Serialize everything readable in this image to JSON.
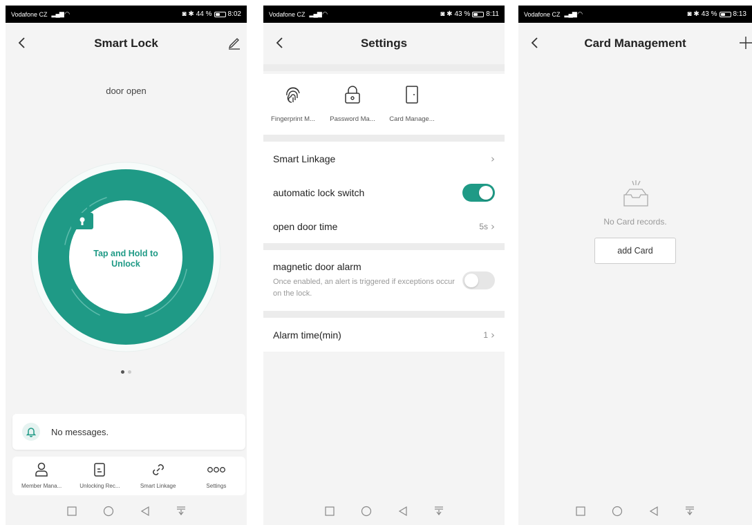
{
  "colors": {
    "accent": "#1f9a86",
    "background": "#f4f4f4",
    "statusbar": "#000000"
  },
  "screen1": {
    "status": {
      "carrier": "Vodafone CZ",
      "battery": "44 %",
      "time": "8:02"
    },
    "title": "Smart Lock",
    "door_status": "door open",
    "unlock_label": "Tap and Hold to Unlock",
    "messages": "No messages.",
    "tabs": [
      {
        "label": "Member Mana...",
        "icon": "person-icon"
      },
      {
        "label": "Unlocking Rec...",
        "icon": "record-icon"
      },
      {
        "label": "Smart Linkage",
        "icon": "link-icon"
      },
      {
        "label": "Settings",
        "icon": "more-icon"
      }
    ]
  },
  "screen2": {
    "status": {
      "carrier": "Vodafone CZ",
      "battery": "43 %",
      "time": "8:11"
    },
    "title": "Settings",
    "functions": [
      {
        "label": "Fingerprint M...",
        "icon": "fingerprint-icon"
      },
      {
        "label": "Password Ma...",
        "icon": "padlock-icon"
      },
      {
        "label": "Card Manage...",
        "icon": "door-icon"
      }
    ],
    "smart_linkage": "Smart Linkage",
    "auto_lock": {
      "label": "automatic lock switch",
      "enabled": true
    },
    "open_door_time": {
      "label": "open door time",
      "value": "5s"
    },
    "magnetic_alarm": {
      "label": "magnetic door alarm",
      "description": "Once enabled, an alert is triggered if exceptions occur on the lock.",
      "enabled": false
    },
    "alarm_time": {
      "label": "Alarm time(min)",
      "value": "1"
    }
  },
  "screen3": {
    "status": {
      "carrier": "Vodafone CZ",
      "battery": "43 %",
      "time": "8:13"
    },
    "title": "Card Management",
    "empty_text": "No Card records.",
    "add_button": "add Card"
  }
}
